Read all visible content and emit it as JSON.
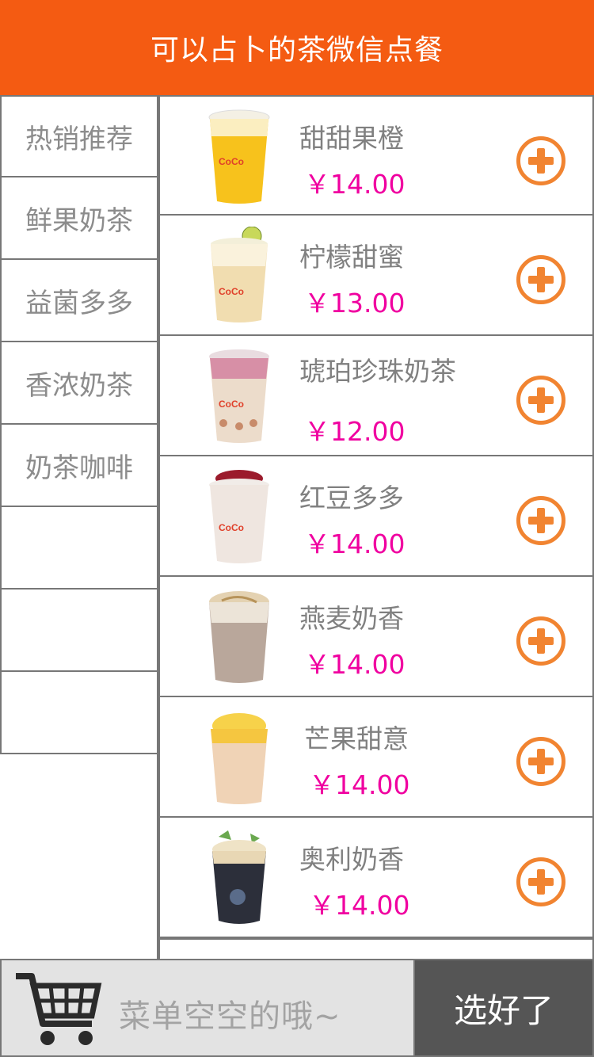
{
  "header": {
    "title": "可以占卜的茶微信点餐"
  },
  "sidebar": {
    "items": [
      {
        "label": "热销推荐"
      },
      {
        "label": "鲜果奶茶"
      },
      {
        "label": "益菌多多"
      },
      {
        "label": "香浓奶茶"
      },
      {
        "label": "奶茶咖啡"
      },
      {
        "label": ""
      },
      {
        "label": ""
      },
      {
        "label": ""
      }
    ]
  },
  "products": [
    {
      "name": "甜甜果橙",
      "price": "￥14.00",
      "image": "orange-drink-cup"
    },
    {
      "name": "柠檬甜蜜",
      "price": "￥13.00",
      "image": "lemon-drink-cup"
    },
    {
      "name": "琥珀珍珠奶茶",
      "price": "￥12.00",
      "image": "pearl-milk-tea-cup"
    },
    {
      "name": "红豆多多",
      "price": "￥14.00",
      "image": "red-bean-drink-cup"
    },
    {
      "name": "燕麦奶香",
      "price": "￥14.00",
      "image": "oat-milk-tea-cup"
    },
    {
      "name": "芒果甜意",
      "price": "￥14.00",
      "image": "mango-drink-cup"
    },
    {
      "name": "奥利奶香",
      "price": "￥14.00",
      "image": "oreo-milk-tea-cup"
    }
  ],
  "cart": {
    "empty_text": "菜单空空的哦~",
    "icon": "cart-icon"
  },
  "actions": {
    "done_label": "选好了"
  },
  "colors": {
    "brand": "#f45b12",
    "price": "#f000a0",
    "add_button": "#f18431",
    "done_bg": "#555555"
  }
}
